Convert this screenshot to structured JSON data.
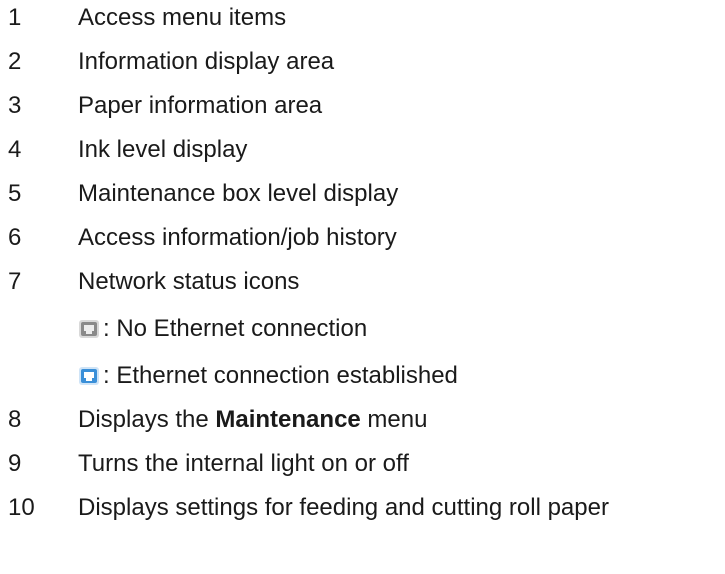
{
  "items": [
    {
      "num": "1",
      "text": "Access menu items"
    },
    {
      "num": "2",
      "text": "Information display area"
    },
    {
      "num": "3",
      "text": "Paper information area"
    },
    {
      "num": "4",
      "text": "Ink level display"
    },
    {
      "num": "5",
      "text": "Maintenance box level display"
    },
    {
      "num": "6",
      "text": "Access information/job history"
    },
    {
      "num": "7",
      "text": "Network status icons"
    },
    {
      "num": "8",
      "text_before": "Displays the ",
      "text_bold": "Maintenance",
      "text_after": " menu"
    },
    {
      "num": "9",
      "text": "Turns the internal light on or off"
    },
    {
      "num": "10",
      "text": "Displays settings for feeding and cutting roll paper"
    }
  ],
  "network_icons": [
    {
      "icon": "ethernet-disconnected-icon",
      "color": "#8a8a8a",
      "text": ": No Ethernet connection"
    },
    {
      "icon": "ethernet-connected-icon",
      "color": "#3a8fd8",
      "text": ": Ethernet connection established"
    }
  ]
}
